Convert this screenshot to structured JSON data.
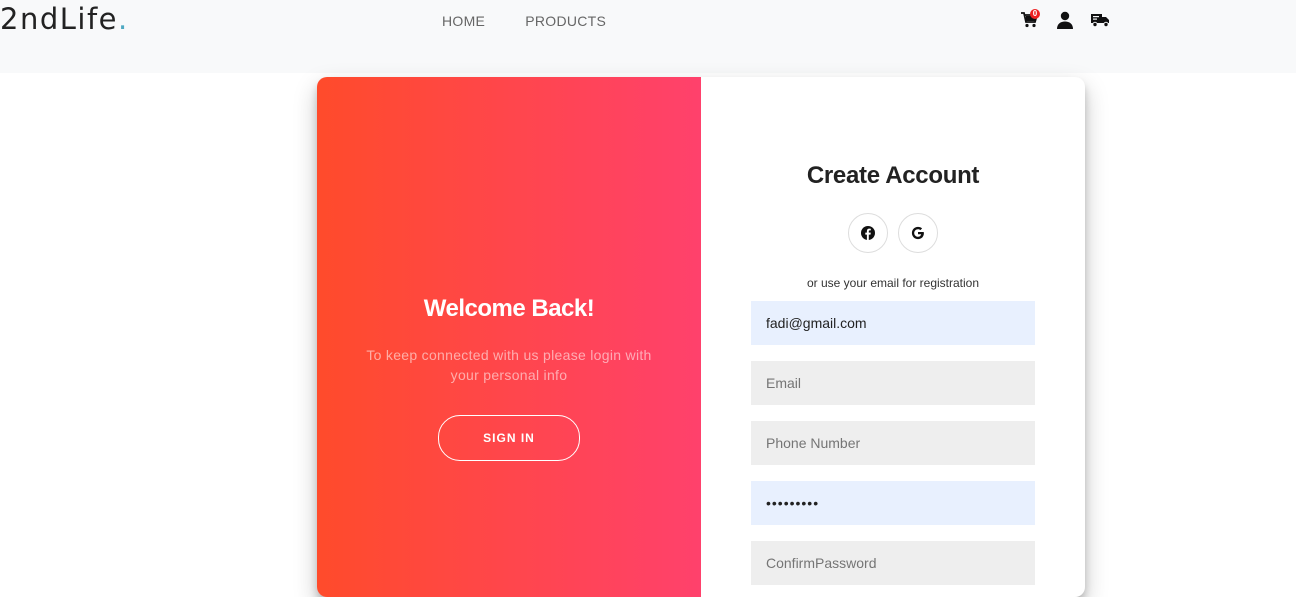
{
  "header": {
    "logo_text": "2ndLife",
    "logo_dot": ".",
    "nav": [
      {
        "label": "HOME"
      },
      {
        "label": "PRODUCTS"
      }
    ],
    "cart_count": "0",
    "icons": [
      "cart-icon",
      "user-icon",
      "truck-icon"
    ]
  },
  "overlay": {
    "title": "Welcome Back!",
    "text": "To keep connected with us please login with your personal info",
    "button_label": "SIGN IN"
  },
  "form": {
    "title": "Create Account",
    "social_icons": [
      "facebook-icon",
      "google-icon"
    ],
    "note": "or use your email for registration",
    "fields": {
      "name": {
        "value": "fadi@gmail.com",
        "placeholder": ""
      },
      "email": {
        "value": "",
        "placeholder": "Email"
      },
      "phone": {
        "value": "",
        "placeholder": "Phone Number"
      },
      "password": {
        "value": "fadi12345",
        "placeholder": ""
      },
      "confirm": {
        "value": "",
        "placeholder": "ConfirmPassword"
      }
    }
  },
  "colors": {
    "gradient_start": "#ff4b2b",
    "gradient_end": "#ff416c",
    "autofill_bg": "#e8f0fe",
    "input_bg": "#eeeeee",
    "logo_dot": "#4fa9c2"
  }
}
